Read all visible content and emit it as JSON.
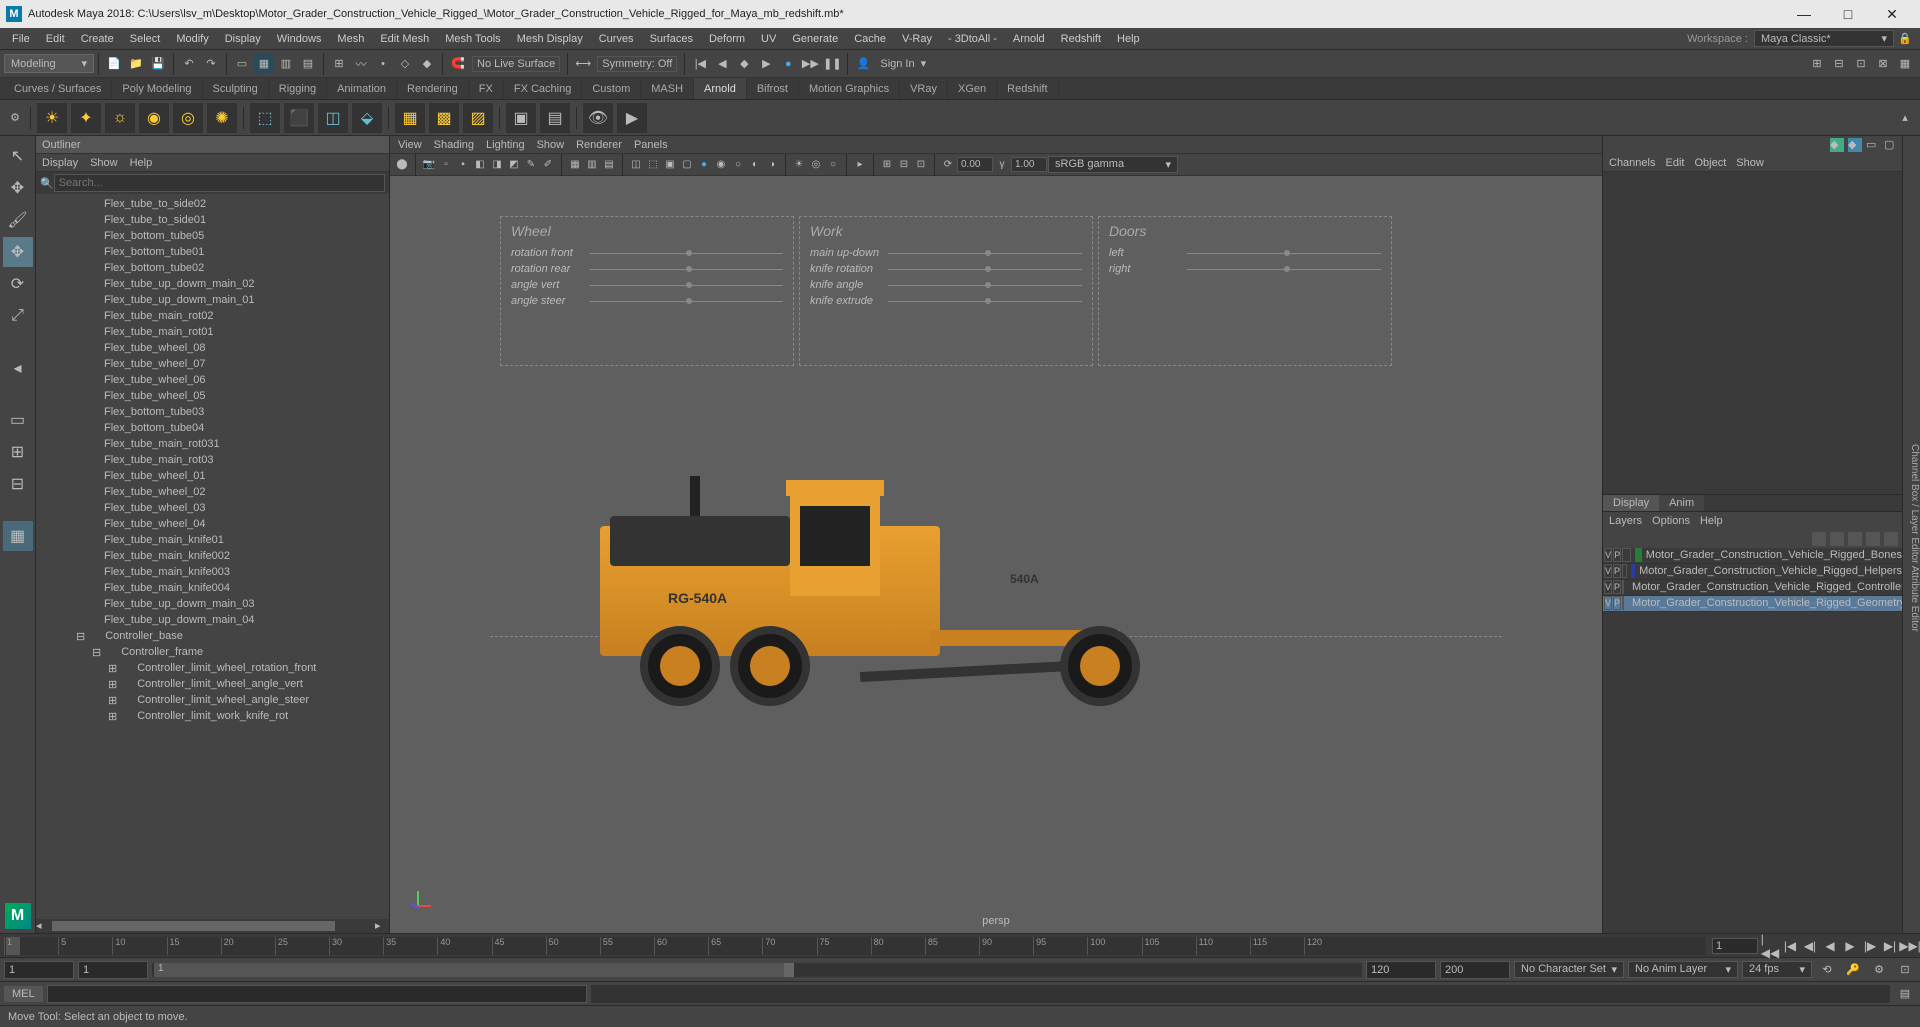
{
  "title": "Autodesk Maya 2018: C:\\Users\\lsv_m\\Desktop\\Motor_Grader_Construction_Vehicle_Rigged_\\Motor_Grader_Construction_Vehicle_Rigged_for_Maya_mb_redshift.mb*",
  "logo": "M",
  "menus": [
    "File",
    "Edit",
    "Create",
    "Select",
    "Modify",
    "Display",
    "Windows",
    "Mesh",
    "Edit Mesh",
    "Mesh Tools",
    "Mesh Display",
    "Curves",
    "Surfaces",
    "Deform",
    "UV",
    "Generate",
    "Cache",
    "V-Ray",
    "- 3DtoAll -",
    "Arnold",
    "Redshift",
    "Help"
  ],
  "workspace_label": "Workspace :",
  "workspace_value": "Maya Classic*",
  "mode": "Modeling",
  "no_live_surface": "No Live Surface",
  "symmetry": "Symmetry: Off",
  "signin": "Sign In",
  "shelf_tabs": [
    "Curves / Surfaces",
    "Poly Modeling",
    "Sculpting",
    "Rigging",
    "Animation",
    "Rendering",
    "FX",
    "FX Caching",
    "Custom",
    "MASH",
    "Arnold",
    "Bifrost",
    "Motion Graphics",
    "VRay",
    "XGen",
    "Redshift"
  ],
  "shelf_active": "Arnold",
  "outliner": {
    "title": "Outliner",
    "menus": [
      "Display",
      "Show",
      "Help"
    ],
    "search_ph": "Search...",
    "items": [
      "Flex_tube_to_side02",
      "Flex_tube_to_side01",
      "Flex_bottom_tube05",
      "Flex_bottom_tube01",
      "Flex_bottom_tube02",
      "Flex_tube_up_dowm_main_02",
      "Flex_tube_up_dowm_main_01",
      "Flex_tube_main_rot02",
      "Flex_tube_main_rot01",
      "Flex_tube_wheel_08",
      "Flex_tube_wheel_07",
      "Flex_tube_wheel_06",
      "Flex_tube_wheel_05",
      "Flex_bottom_tube03",
      "Flex_bottom_tube04",
      "Flex_tube_main_rot031",
      "Flex_tube_main_rot03",
      "Flex_tube_wheel_01",
      "Flex_tube_wheel_02",
      "Flex_tube_wheel_03",
      "Flex_tube_wheel_04",
      "Flex_tube_main_knife01",
      "Flex_tube_main_knife002",
      "Flex_tube_main_knife003",
      "Flex_tube_main_knife004",
      "Flex_tube_up_dowm_main_03",
      "Flex_tube_up_dowm_main_04"
    ],
    "ctrl_base": "Controller_base",
    "ctrl_frame": "Controller_frame",
    "ctrl_children": [
      "Controller_limit_wheel_rotation_front",
      "Controller_limit_wheel_angle_vert",
      "Controller_limit_wheel_angle_steer",
      "Controller_limit_work_knife_rot"
    ]
  },
  "viewport": {
    "menus": [
      "View",
      "Shading",
      "Lighting",
      "Show",
      "Renderer",
      "Panels"
    ],
    "num1": "0.00",
    "num2": "1.00",
    "gamma": "sRGB gamma",
    "camera": "persp",
    "ctrl_panels": {
      "wheel": {
        "title": "Wheel",
        "rows": [
          "rotation front",
          "rotation rear",
          "angle vert",
          "angle steer"
        ]
      },
      "work": {
        "title": "Work",
        "rows": [
          "main up-down",
          "knife rotation",
          "knife angle",
          "knife extrude"
        ]
      },
      "doors": {
        "title": "Doors",
        "rows": [
          "left",
          "right"
        ]
      }
    },
    "grader_label": "RG-540A",
    "grader_label2": "540A"
  },
  "channelbox": {
    "menus": [
      "Channels",
      "Edit",
      "Object",
      "Show"
    ],
    "tabs": [
      "Display",
      "Anim"
    ],
    "layers_menus": [
      "Layers",
      "Options",
      "Help"
    ],
    "layers": [
      {
        "v": "V",
        "p": "P",
        "color": "#2a7a3a",
        "name": "Motor_Grader_Construction_Vehicle_Rigged_Bones"
      },
      {
        "v": "V",
        "p": "P",
        "color": "#2a3aaa",
        "name": "Motor_Grader_Construction_Vehicle_Rigged_Helpers"
      },
      {
        "v": "V",
        "p": "P",
        "color": "#2a2aaa",
        "name": "Motor_Grader_Construction_Vehicle_Rigged_Controllers"
      },
      {
        "v": "V",
        "p": "P",
        "color": "#c02a4a",
        "name": "Motor_Grader_Construction_Vehicle_Rigged_Geometry"
      }
    ]
  },
  "timeline": {
    "ticks": [
      1,
      5,
      10,
      15,
      20,
      25,
      30,
      35,
      40,
      45,
      50,
      55,
      60,
      65,
      70,
      75,
      80,
      85,
      90,
      95,
      100,
      105,
      110,
      115,
      120
    ],
    "current": "1",
    "range_start_out": "1",
    "range_start_in": "1",
    "range_val": "1",
    "range_end_in": "120",
    "range_end_out": "200",
    "charset": "No Character Set",
    "animlayer": "No Anim Layer",
    "fps": "24 fps"
  },
  "cmd_label": "MEL",
  "status_text": "Move Tool: Select an object to move.",
  "rside_label": "Channel Box / Layer Editor    Attribute Editor"
}
